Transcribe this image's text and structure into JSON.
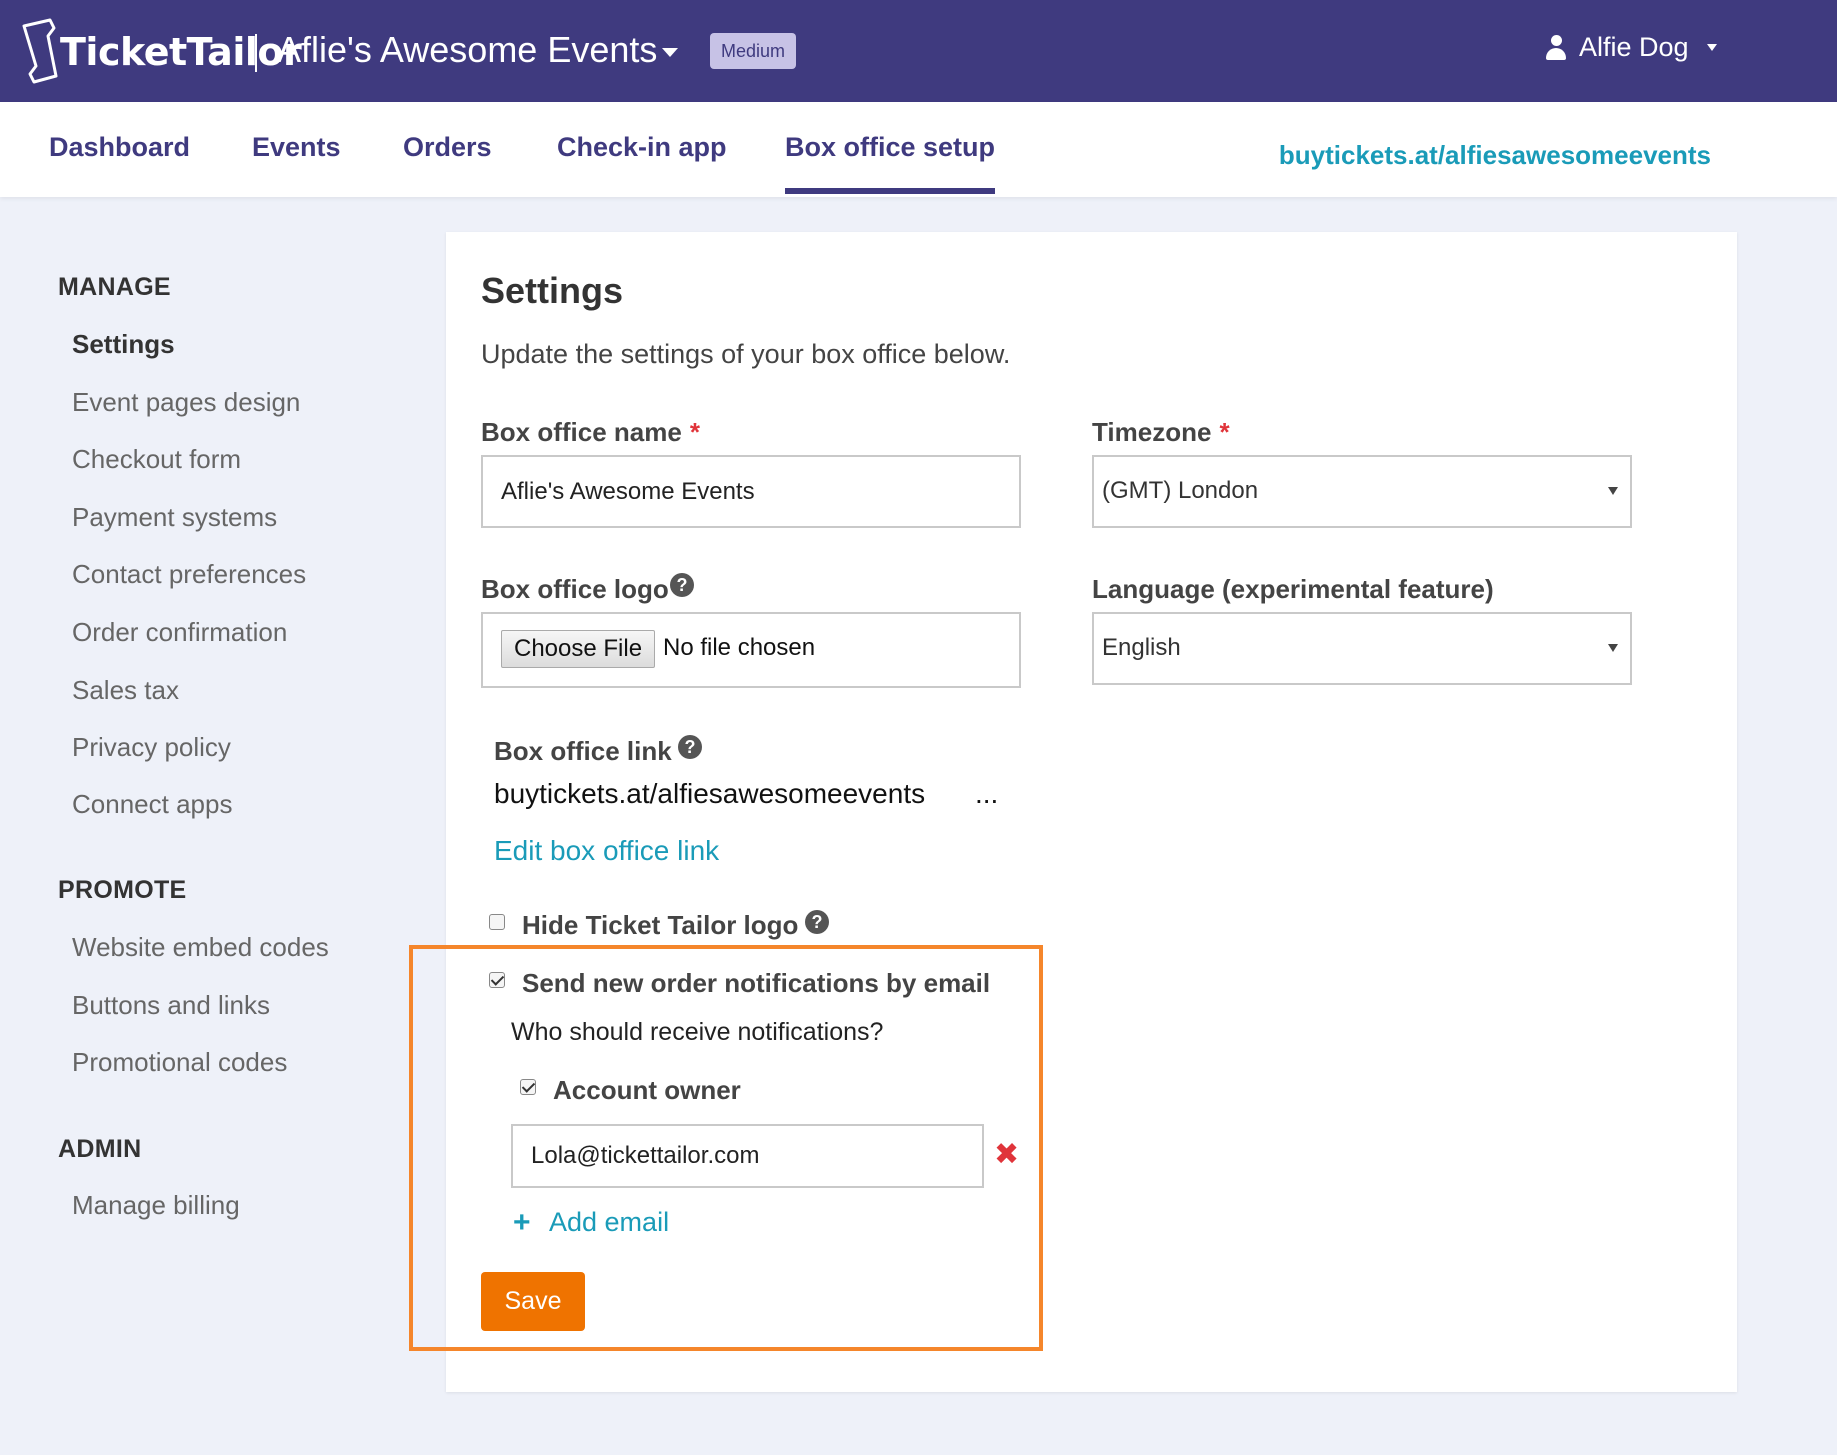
{
  "header": {
    "logo_text": "TicketTailor",
    "org_name": "Aflie's Awesome Events",
    "plan_badge": "Medium",
    "user_name": "Alfie Dog"
  },
  "nav": {
    "tabs": [
      {
        "label": "Dashboard"
      },
      {
        "label": "Events"
      },
      {
        "label": "Orders"
      },
      {
        "label": "Check-in app"
      },
      {
        "label": "Box office setup"
      }
    ],
    "active_tab": "Box office setup",
    "box_office_url": "buytickets.at/alfiesawesomeevents"
  },
  "sidebar": {
    "manage_heading": "MANAGE",
    "manage_items": [
      {
        "label": "Settings"
      },
      {
        "label": "Event pages design"
      },
      {
        "label": "Checkout form"
      },
      {
        "label": "Payment systems"
      },
      {
        "label": "Contact preferences"
      },
      {
        "label": "Order confirmation"
      },
      {
        "label": "Sales tax"
      },
      {
        "label": "Privacy policy"
      },
      {
        "label": "Connect apps"
      }
    ],
    "promote_heading": "PROMOTE",
    "promote_items": [
      {
        "label": "Website embed codes"
      },
      {
        "label": "Buttons and links"
      },
      {
        "label": "Promotional codes"
      }
    ],
    "admin_heading": "ADMIN",
    "admin_items": [
      {
        "label": "Manage billing"
      }
    ]
  },
  "settings": {
    "title": "Settings",
    "subtitle": "Update the settings of your box office below.",
    "box_office_name_label": "Box office name",
    "box_office_name_value": "Aflie's Awesome Events",
    "required_mark": "*",
    "timezone_label": "Timezone",
    "timezone_value": "(GMT) London",
    "logo_label": "Box office logo",
    "file_button": "Choose File",
    "file_status": "No file chosen",
    "language_label": "Language (experimental feature)",
    "language_value": "English",
    "link_label": "Box office link",
    "link_value": "buytickets.at/alfiesawesomeevents",
    "link_ellipsis": "...",
    "edit_link": "Edit box office link",
    "hide_logo_label": "Hide Ticket Tailor logo",
    "hide_logo_checked": false,
    "notify_label": "Send new order notifications by email",
    "notify_checked": true,
    "recipients_question": "Who should receive notifications?",
    "account_owner_label": "Account owner",
    "account_owner_checked": true,
    "email_value": "Lola@tickettailor.com",
    "add_email": "Add email",
    "save_button": "Save",
    "help_glyph": "?"
  },
  "colors": {
    "header_bg": "#3f3a7f",
    "link_teal": "#1a9bb8",
    "save_orange": "#ef7300",
    "highlight_orange": "#f5862b",
    "required_red": "#e0343a"
  }
}
